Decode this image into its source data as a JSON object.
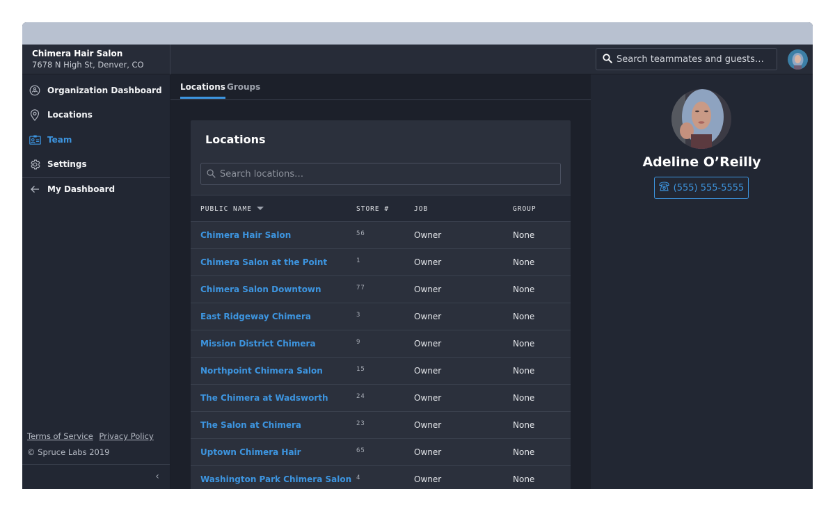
{
  "org": {
    "name": "Chimera Hair Salon",
    "address": "7678 N High St, Denver, CO"
  },
  "header": {
    "search_placeholder": "Search teammates and guests…",
    "search_icon": "search-icon",
    "avatar_icon": "user-avatar"
  },
  "sidebar": {
    "items": [
      {
        "label": "Organization Dashboard",
        "icon": "dashboard-gauge-icon",
        "active": false
      },
      {
        "label": "Locations",
        "icon": "map-pin-icon",
        "active": false
      },
      {
        "label": "Team",
        "icon": "id-card-icon",
        "active": true
      },
      {
        "label": "Settings",
        "icon": "gear-icon",
        "active": false
      }
    ],
    "back_item": {
      "label": "My Dashboard",
      "icon": "arrow-left-icon"
    },
    "footer": {
      "terms": "Terms of Service",
      "privacy": "Privacy Policy",
      "copyright": "© Spruce Labs 2019"
    },
    "collapse_icon": "‹"
  },
  "main": {
    "tabs": [
      {
        "label": "Locations",
        "active": true
      },
      {
        "label": "Groups",
        "active": false
      }
    ],
    "card": {
      "title": "Locations",
      "search_placeholder": "Search locations…",
      "columns": [
        "PUBLIC NAME",
        "STORE #",
        "JOB",
        "GROUP"
      ],
      "sort_column": "PUBLIC NAME",
      "rows": [
        {
          "name": "Chimera Hair Salon",
          "store": "56",
          "job": "Owner",
          "group": "None"
        },
        {
          "name": "Chimera Salon at the Point",
          "store": "1",
          "job": "Owner",
          "group": "None"
        },
        {
          "name": "Chimera Salon Downtown",
          "store": "77",
          "job": "Owner",
          "group": "None"
        },
        {
          "name": "East Ridgeway Chimera",
          "store": "3",
          "job": "Owner",
          "group": "None"
        },
        {
          "name": "Mission District Chimera",
          "store": "9",
          "job": "Owner",
          "group": "None"
        },
        {
          "name": "Northpoint Chimera Salon",
          "store": "15",
          "job": "Owner",
          "group": "None"
        },
        {
          "name": "The Chimera at Wadsworth",
          "store": "24",
          "job": "Owner",
          "group": "None"
        },
        {
          "name": "The Salon at Chimera",
          "store": "23",
          "job": "Owner",
          "group": "None"
        },
        {
          "name": "Uptown Chimera Hair",
          "store": "65",
          "job": "Owner",
          "group": "None"
        },
        {
          "name": "Washington Park Chimera Salon",
          "store": "4",
          "job": "Owner",
          "group": "None"
        }
      ]
    }
  },
  "profile": {
    "name": "Adeline O’Reilly",
    "phone": "(555) 555-5555",
    "phone_icon": "phone-icon"
  },
  "colors": {
    "accent": "#3d95e0",
    "titlebar": "#b8c1d0",
    "header_bg": "#272c38",
    "sidebar_bg": "#222733",
    "main_bg": "#1c202a",
    "card_bg": "#2b303c"
  }
}
